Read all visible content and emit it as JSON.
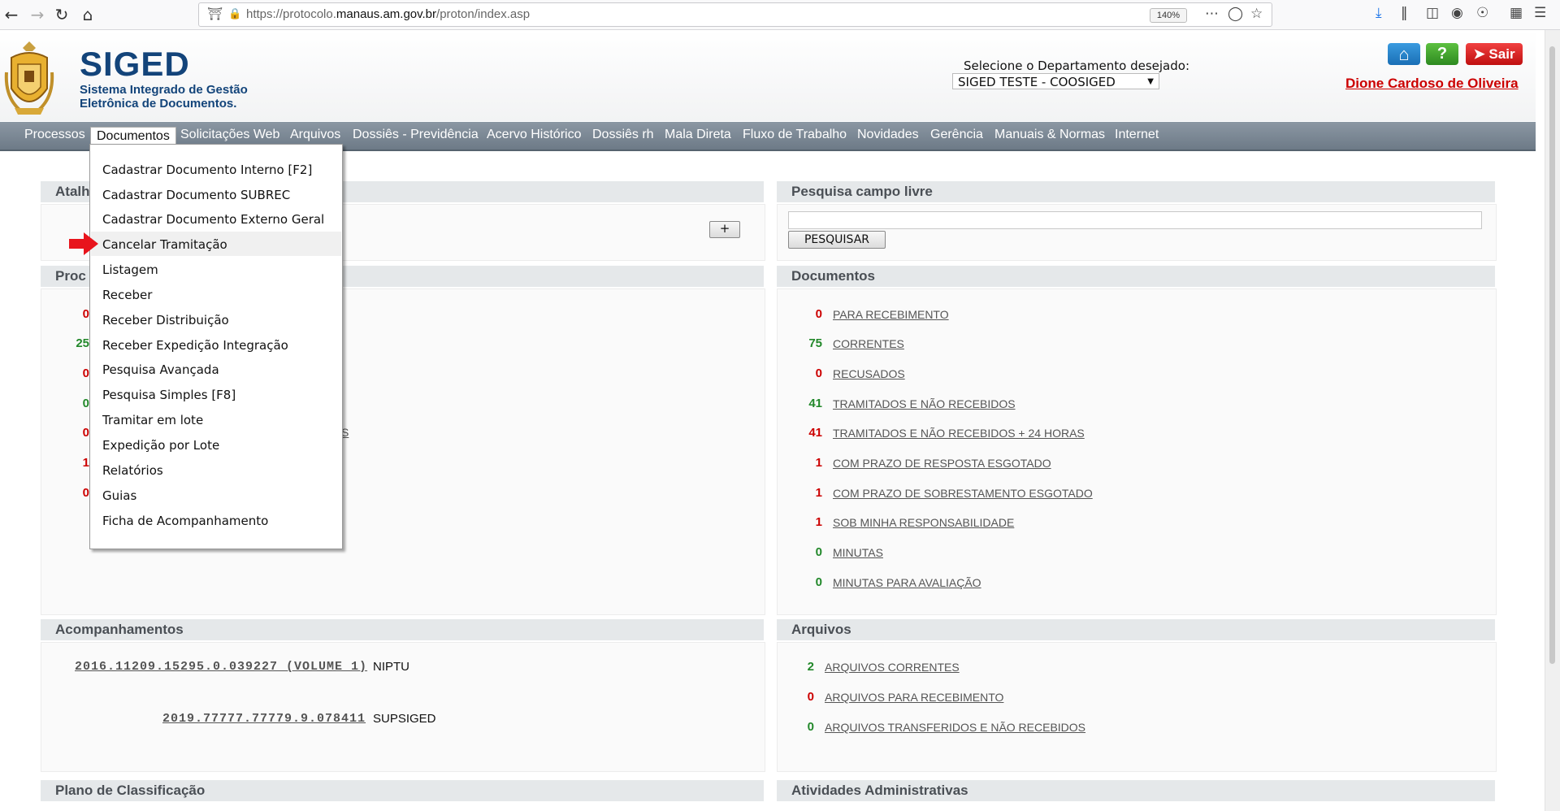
{
  "browser": {
    "url_prefix": "https://protocolo.",
    "url_domain": "manaus.am.gov.br",
    "url_suffix": "/proton/index.asp",
    "zoom": "140%"
  },
  "header": {
    "title": "SIGED",
    "subtitle": "Sistema Integrado de Gestão Eletrônica de Documentos.",
    "dept_label": "Selecione o Departamento desejado:",
    "dept_selected": "SIGED TESTE - COOSIGED",
    "exit_label": "Sair",
    "help_label": "?",
    "user_name": "Dione Cardoso de Oliveira"
  },
  "menu": [
    "Processos",
    "Documentos",
    "Solicitações Web",
    "Arquivos",
    "Dossiês - Previdência",
    "Acervo Histórico",
    "Dossiês rh",
    "Mala Direta",
    "Fluxo de Trabalho",
    "Novidades",
    "Gerência",
    "Manuais & Normas",
    "Internet"
  ],
  "dropdown": [
    "Cadastrar Documento Interno [F2]",
    "Cadastrar Documento SUBREC",
    "Cadastrar Documento Externo Geral",
    "Cancelar Tramitação",
    "Listagem",
    "Receber",
    "Receber Distribuição",
    "Receber Expedição Integração",
    "Pesquisa Avançada",
    "Pesquisa Simples [F8]",
    "Tramitar em lote",
    "Expedição por Lote",
    "Relatórios",
    "Guias",
    "Ficha de Acompanhamento"
  ],
  "left": {
    "atalhos_partial": "Atalh",
    "processos_partial": "Proc",
    "plus": "+",
    "counts_partial": [
      "0",
      "25",
      "0",
      "0",
      "0",
      "1",
      "0"
    ],
    "link_fragment": "S"
  },
  "search": {
    "title": "Pesquisa campo livre",
    "button": "PESQUISAR"
  },
  "documentos": {
    "title": "Documentos",
    "items": [
      {
        "count": "0",
        "label": "PARA RECEBIMENTO"
      },
      {
        "count": "75",
        "label": "CORRENTES"
      },
      {
        "count": "0",
        "label": "RECUSADOS"
      },
      {
        "count": "41",
        "label": "TRAMITADOS E NÃO RECEBIDOS"
      },
      {
        "count": "41",
        "label": "TRAMITADOS E NÃO RECEBIDOS + 24 HORAS"
      },
      {
        "count": "1",
        "label": "COM PRAZO DE RESPOSTA ESGOTADO"
      },
      {
        "count": "1",
        "label": "COM PRAZO DE SOBRESTAMENTO ESGOTADO"
      },
      {
        "count": "1",
        "label": "SOB MINHA RESPONSABILIDADE"
      },
      {
        "count": "0",
        "label": "MINUTAS"
      },
      {
        "count": "0",
        "label": "MINUTAS PARA AVALIAÇÃO"
      }
    ]
  },
  "acompanhamentos": {
    "title": "Acompanhamentos",
    "items": [
      {
        "number": "2016.11209.15295.0.039227 (VOLUME 1)",
        "unit": "NIPTU"
      },
      {
        "number": "2019.77777.77779.9.078411",
        "unit": "SUPSIGED"
      }
    ]
  },
  "arquivos": {
    "title": "Arquivos",
    "items": [
      {
        "count": "2",
        "label": "ARQUIVOS CORRENTES"
      },
      {
        "count": "0",
        "label": "ARQUIVOS PARA RECEBIMENTO"
      },
      {
        "count": "0",
        "label": "ARQUIVOS TRANSFERIDOS E NÃO RECEBIDOS"
      }
    ]
  },
  "bottom": {
    "plano": "Plano de Classificação",
    "atividades": "Atividades Administrativas"
  },
  "colors": {
    "brand": "#13447a",
    "menubar": "#7a8693",
    "count_red": "#cc0000",
    "count_green": "#22882a",
    "user_red": "#cc0000"
  }
}
